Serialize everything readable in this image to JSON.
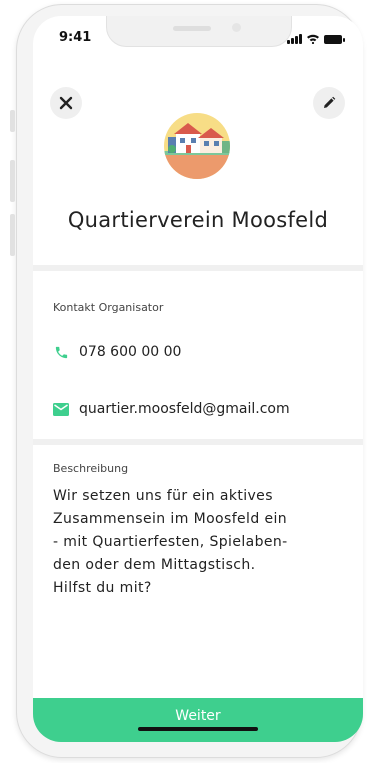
{
  "status_bar": {
    "time": "9:41"
  },
  "header": {
    "title": "Quartierverein Moosfeld"
  },
  "contact": {
    "section_label": "Kontakt Organisator",
    "phone": "078 600 00 00",
    "email": "quartier.moosfeld@gmail.com"
  },
  "description": {
    "section_label": "Beschreibung",
    "lines": [
      "Wir setzen uns für ein aktives",
      "Zusammensein im Moosfeld ein",
      "- mit Quartierfesten, Spielaben-",
      "den oder dem Mittagstisch.",
      "Hilfst du mit?"
    ]
  },
  "footer": {
    "continue_label": "Weiter"
  },
  "colors": {
    "accent": "#3ecf8e",
    "text": "#222222",
    "background": "#f0f0f0"
  },
  "icons": {
    "close": "close-icon",
    "edit": "pencil-icon",
    "phone": "phone-icon",
    "email": "mail-icon",
    "logo": "village-houses-logo"
  }
}
